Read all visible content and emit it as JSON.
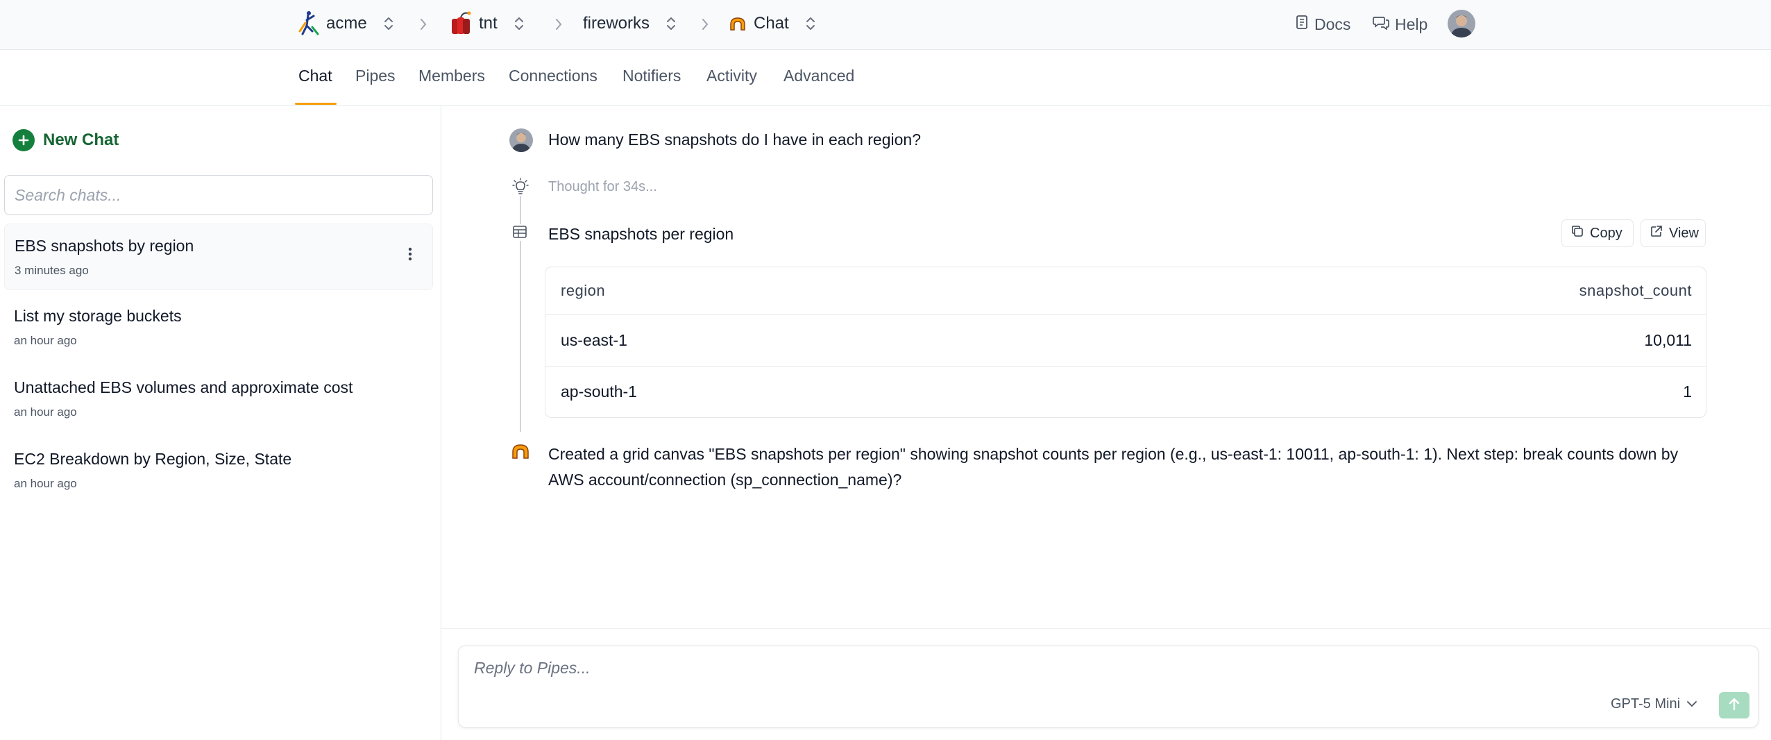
{
  "breadcrumb": [
    {
      "label": "acme",
      "icon": "acme-logo-icon"
    },
    {
      "label": "tnt",
      "icon": "tnt-logo-icon"
    },
    {
      "label": "fireworks",
      "icon": ""
    },
    {
      "label": "Chat",
      "icon": "pipes-logo-icon"
    }
  ],
  "top_links": {
    "docs": "Docs",
    "help": "Help"
  },
  "tabs": [
    {
      "label": "Chat",
      "active": true
    },
    {
      "label": "Pipes",
      "active": false
    },
    {
      "label": "Members",
      "active": false
    },
    {
      "label": "Connections",
      "active": false
    },
    {
      "label": "Notifiers",
      "active": false
    },
    {
      "label": "Activity",
      "active": false
    },
    {
      "label": "Advanced",
      "active": false
    }
  ],
  "sidebar": {
    "new_chat_label": "New Chat",
    "search_placeholder": "Search chats...",
    "chats": [
      {
        "title": "EBS snapshots by region",
        "time": "3 minutes ago",
        "selected": true
      },
      {
        "title": "List my storage buckets",
        "time": "an hour ago",
        "selected": false
      },
      {
        "title": "Unattached EBS volumes and approximate cost",
        "time": "an hour ago",
        "selected": false
      },
      {
        "title": "EC2 Breakdown by Region, Size, State",
        "time": "an hour ago",
        "selected": false
      }
    ]
  },
  "conversation": {
    "user_message": "How many EBS snapshots do I have in each region?",
    "thought": "Thought for 34s...",
    "canvas": {
      "title": "EBS snapshots per region",
      "copy_label": "Copy",
      "view_label": "View",
      "columns": [
        "region",
        "snapshot_count"
      ],
      "rows": [
        [
          "us-east-1",
          "10,011"
        ],
        [
          "ap-south-1",
          "1"
        ]
      ]
    },
    "assistant_message": "Created a grid canvas \"EBS snapshots per region\" showing snapshot counts per region (e.g., us-east-1: 10011, ap-south-1: 1). Next step: break counts down by AWS account/connection (sp_connection_name)?"
  },
  "composer": {
    "placeholder": "Reply to Pipes...",
    "model": "GPT-5 Mini"
  },
  "colors": {
    "accent_tab": "#f59e0b",
    "new_chat_green": "#15803d",
    "send_button": "#a7dcc0"
  }
}
